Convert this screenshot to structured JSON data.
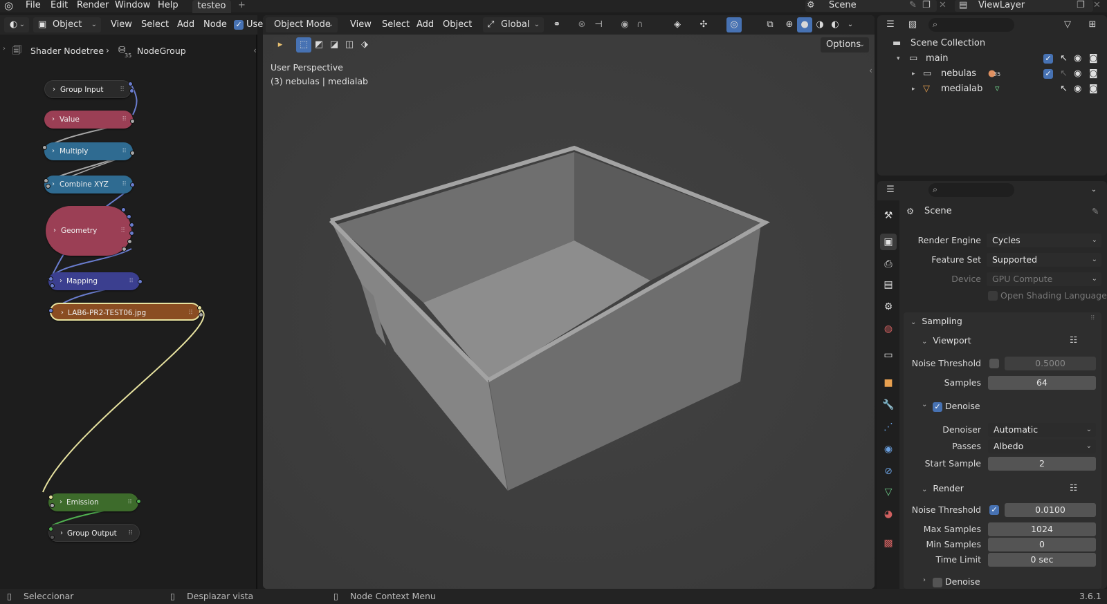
{
  "topbar": {
    "menus": [
      "File",
      "Edit",
      "Render",
      "Window",
      "Help"
    ],
    "workspace_tab": "testeo",
    "add_tab": "+",
    "scene": "Scene",
    "view_layer": "ViewLayer"
  },
  "node_editor": {
    "header": {
      "mode": "Object",
      "menus": [
        "View",
        "Select",
        "Add",
        "Node"
      ],
      "use_label": "Use"
    },
    "breadcrumb": {
      "tree": "Shader Nodetree",
      "group": "NodeGroup",
      "group_badge": "35"
    },
    "nodes": [
      {
        "label": "Group Input",
        "color": "#2a2a2a"
      },
      {
        "label": "Value",
        "color": "#9b3f55"
      },
      {
        "label": "Multiply",
        "color": "#2f6b91"
      },
      {
        "label": "Combine XYZ",
        "color": "#2f6b91"
      },
      {
        "label": "Geometry",
        "color": "#9b3f55"
      },
      {
        "label": "Mapping",
        "color": "#3b3f8f"
      },
      {
        "label": "LAB6-PR2-TEST06.jpg",
        "color": "#8a4d22"
      },
      {
        "label": "Emission",
        "color": "#3d6b2b"
      },
      {
        "label": "Group Output",
        "color": "#2a2a2a"
      }
    ]
  },
  "viewport": {
    "header": {
      "mode": "Object Mode",
      "menus": [
        "View",
        "Select",
        "Add",
        "Object"
      ],
      "orientation": "Global"
    },
    "options": "Options",
    "overlay_title": "User Perspective",
    "overlay_sub": "(3) nebulas | medialab"
  },
  "outliner": {
    "collection": "Scene Collection",
    "rows": [
      {
        "name": "main"
      },
      {
        "name": "nebulas",
        "badge": "35"
      },
      {
        "name": "medialab"
      }
    ]
  },
  "properties": {
    "title": "Scene",
    "render_engine_label": "Render Engine",
    "render_engine": "Cycles",
    "feature_set_label": "Feature Set",
    "feature_set": "Supported",
    "device_label": "Device",
    "device": "GPU Compute",
    "osl_label": "Open Shading Language",
    "sampling": "Sampling",
    "viewport": "Viewport",
    "vp_noise_label": "Noise Threshold",
    "vp_noise": "0.5000",
    "vp_samples_label": "Samples",
    "vp_samples": "64",
    "denoise": "Denoise",
    "denoiser_label": "Denoiser",
    "denoiser": "Automatic",
    "passes_label": "Passes",
    "passes": "Albedo",
    "start_sample_label": "Start Sample",
    "start_sample": "2",
    "render": "Render",
    "r_noise_label": "Noise Threshold",
    "r_noise": "0.0100",
    "max_samples_label": "Max Samples",
    "max_samples": "1024",
    "min_samples_label": "Min Samples",
    "min_samples": "0",
    "time_limit_label": "Time Limit",
    "time_limit": "0 sec",
    "denoise2": "Denoise"
  },
  "statusbar": {
    "select": "Seleccionar",
    "pan": "Desplazar vista",
    "context": "Node Context Menu",
    "version": "3.6.1"
  },
  "colors": {
    "accent": "#4772b3",
    "link_yellow": "#e8e3a0",
    "box_light": "#9a9a9a"
  }
}
